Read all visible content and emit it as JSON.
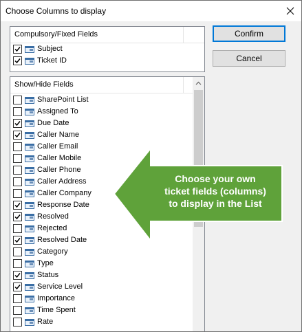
{
  "window": {
    "title": "Choose Columns to display",
    "close_icon": "close-icon"
  },
  "fixed_fields": {
    "header": "Compulsory/Fixed Fields",
    "items": [
      {
        "label": "Subject",
        "checked": true
      },
      {
        "label": "Ticket ID",
        "checked": true
      }
    ]
  },
  "show_hide_fields": {
    "header": "Show/Hide Fields",
    "items": [
      {
        "label": "SharePoint List",
        "checked": false
      },
      {
        "label": "Assigned To",
        "checked": false
      },
      {
        "label": "Due Date",
        "checked": true
      },
      {
        "label": "Caller Name",
        "checked": true
      },
      {
        "label": "Caller Email",
        "checked": false
      },
      {
        "label": "Caller Mobile",
        "checked": false
      },
      {
        "label": "Caller Phone",
        "checked": false
      },
      {
        "label": "Caller Address",
        "checked": false
      },
      {
        "label": "Caller Company",
        "checked": false
      },
      {
        "label": "Response Date",
        "checked": true
      },
      {
        "label": "Resolved",
        "checked": true
      },
      {
        "label": "Rejected",
        "checked": false
      },
      {
        "label": "Resolved Date",
        "checked": true
      },
      {
        "label": "Category",
        "checked": false
      },
      {
        "label": "Type",
        "checked": false
      },
      {
        "label": "Status",
        "checked": true
      },
      {
        "label": "Service Level",
        "checked": true
      },
      {
        "label": "Importance",
        "checked": false
      },
      {
        "label": "Time Spent",
        "checked": false
      },
      {
        "label": "Rate",
        "checked": false
      }
    ]
  },
  "buttons": {
    "confirm": "Confirm",
    "cancel": "Cancel"
  },
  "callout": {
    "lines": [
      "Choose your own",
      "ticket fields (columns)",
      "to display in the List"
    ],
    "color": "#5fa23a"
  },
  "colors": {
    "accent": "#0078d7",
    "arrow_green": "#5fa23a",
    "check_blue_icon": "#3a6ea5"
  }
}
